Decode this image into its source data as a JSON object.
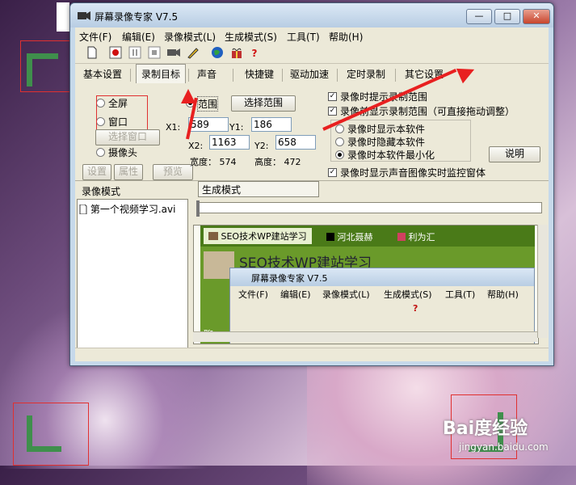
{
  "app": {
    "title": "屏幕录像专家 V7.5",
    "window_buttons": {
      "minimize": "—",
      "restore": "□",
      "close": "✕"
    }
  },
  "menu": [
    "文件(F)",
    "编辑(E)",
    "录像模式(L)",
    "生成模式(S)",
    "工具(T)",
    "帮助(H)"
  ],
  "toolbar_icons": [
    "new-icon",
    "record-icon",
    "pause-icon",
    "stop-icon",
    "camera-icon",
    "pen-icon",
    "globe-icon",
    "gift-icon",
    "help-icon"
  ],
  "tabs": [
    "基本设置",
    "录制目标",
    "声音",
    "快捷键",
    "驱动加速",
    "定时录制",
    "其它设置"
  ],
  "record_target": {
    "fullscreen": "全屏",
    "window": "窗口",
    "select_window": "选择窗口",
    "camera": "摄像头",
    "settings": "设置",
    "properties": "属性",
    "preview": "预览",
    "range": "范围",
    "select_range": "选择范围",
    "x1_label": "X1:",
    "x1_value": "589",
    "y1_label": "Y1:",
    "y1_value": "186",
    "x2_label": "X2:",
    "x2_value": "1163",
    "y2_label": "Y2:",
    "y2_value": "658",
    "width_text": "宽度： 574",
    "height_text": "高度： 472"
  },
  "options": {
    "show_range_hint": "录像时提示录制范围",
    "show_range_before": "录像前显示录制范围（可直接拖动调整）",
    "show_software": "录像时显示本软件",
    "hide_software": "录像时隐藏本软件",
    "minimize_software": "录像时本软件最小化",
    "explain_button": "说明",
    "realtime_monitor": "录像时显示声音图像实时监控窗体"
  },
  "panels": {
    "record_mode": "录像模式",
    "generate_mode": "生成模式",
    "file_item": "第一个视频学习.avi"
  },
  "preview": {
    "browser_tab1": "SEO技术WP建站学习",
    "browser_tab2": "河北聂赫",
    "browser_tab3": "利为汇",
    "page_heading": "SEO技术WP建站学习",
    "inner_title": "屏幕录像专家 V7.5",
    "inner_menu": [
      "文件(F)",
      "编辑(E)",
      "录像模式(L)",
      "生成模式(S)",
      "工具(T)",
      "帮助(H)"
    ],
    "inner_left_label": "聊"
  },
  "watermark": {
    "logo": "Bai度经验",
    "url": "jingyan.baidu.com"
  },
  "colors": {
    "annotation": "#e03030",
    "corner": "#3f8f4c"
  }
}
